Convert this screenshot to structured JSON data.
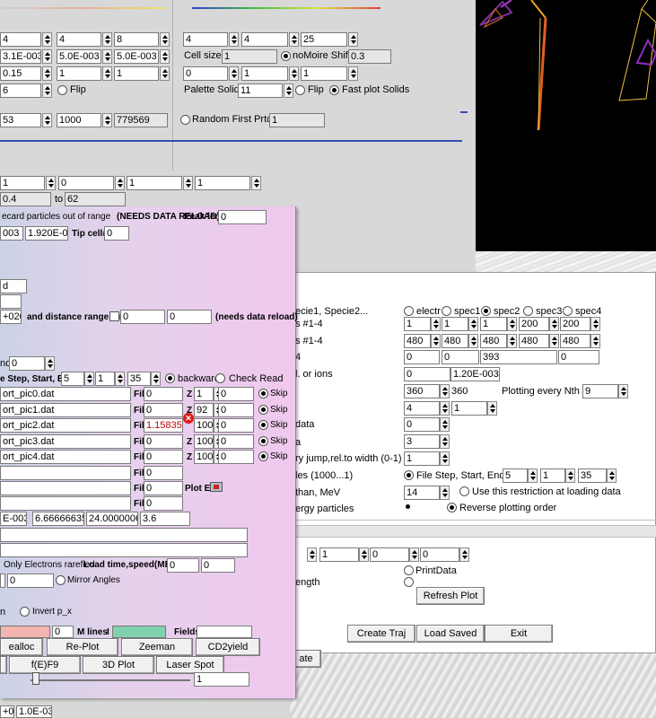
{
  "top": {
    "row1": {
      "a": "4",
      "b": "4",
      "c": "8",
      "d": "4",
      "e": "4",
      "f": "25"
    },
    "row2": {
      "a": "3.1E-003",
      "b": "5.0E-003",
      "c": "5.0E-003",
      "cell_size_label": "Cell size",
      "cell_size": "1",
      "nomoire_label": "noMoire Shift",
      "nomoire": "0.3"
    },
    "row3": {
      "a": "0.15",
      "b": "1",
      "c": "1",
      "d": "0",
      "e": "1",
      "f": "1"
    },
    "row4": {
      "a": "6",
      "flip_label": "Flip",
      "palette_label": "Palette Solid",
      "palette": "11",
      "flip2_label": "Flip",
      "fast_label": "Fast plot Solids"
    },
    "row5": {
      "a": "53",
      "b": "1000",
      "c": "779569",
      "random_label": "Random First Prtcl",
      "random": "1"
    },
    "row6": {
      "a": "1",
      "b": "0",
      "c": "1",
      "d": "1"
    },
    "row7": {
      "a": "0.4",
      "to_label": "to",
      "b": "62"
    }
  },
  "pink": {
    "discard_label": "ecard particles out of range",
    "needs_reload": "(NEEDS DATA RELOAD)",
    "peak_label": "Peak leng",
    "peak": "0",
    "r2": {
      "a": "003",
      "b": "1.920E-003",
      "tip_label": "Tip cell#",
      "tip": "0"
    },
    "r3": {
      "a": "d"
    },
    "r4": {
      "a": ""
    },
    "r5": {
      "a": "+020",
      "dist_label": "and distance range [cm]",
      "b": "0",
      "c": "0",
      "needs_reload": "(needs data reload)"
    },
    "r6": {
      "a": "nd",
      "b": "0"
    },
    "r7": {
      "step_label": "e Step, Start, End",
      "a": "5",
      "b": "1",
      "c": "35",
      "backward_label": "backward",
      "check_label": "Check Read"
    },
    "files": [
      {
        "name": "ort_pic0.dat",
        "fill": "0",
        "z": "1",
        "v": "0",
        "skip": "Skip"
      },
      {
        "name": "ort_pic1.dat",
        "fill": "0",
        "z": "92",
        "v": "0",
        "skip": "Skip"
      },
      {
        "name": "ort_pic2.dat",
        "fill": "1.158359",
        "z": "100",
        "v": "0",
        "skip": "Skip"
      },
      {
        "name": "ort_pic3.dat",
        "fill": "0",
        "z": "100",
        "v": "0",
        "skip": "Skip"
      },
      {
        "name": "ort_pic4.dat",
        "fill": "0",
        "z": "100",
        "v": "0",
        "skip": "Skip"
      }
    ],
    "fill_label": "Fill",
    "z_label": "Z",
    "extra_fill": [
      "0",
      "0",
      "0"
    ],
    "plot_ex_label": "Plot Ex",
    "r14": {
      "a": "E-003",
      "b": "6.66666635",
      "c": "24.00000061",
      "d": "3.6"
    },
    "only_electrons": "Only Electrons rarefied",
    "load_time_label": "Load time,speed(MBps):",
    "load_a": "0",
    "load_b": "0",
    "mirror": {
      "a": "",
      "b": "0",
      "label": "Mirror Angles"
    },
    "invert": {
      "pre": "n",
      "label": "Invert p_x"
    },
    "mlines": {
      "a": "0",
      "label": "M lines",
      "sep": "I",
      "fields_label": "Fields"
    },
    "buttons1": [
      "ealloc",
      "Re-Plot",
      "Zeeman",
      "CD2yield"
    ],
    "buttons2": [
      "",
      "f(E)F9",
      "3D Plot",
      "Laser Spot"
    ],
    "slider_val": "1",
    "bottom": {
      "a": "+03",
      "b": "1.0E-03"
    }
  },
  "white": {
    "species_label": "ecie1, Specie2...",
    "species": [
      "electr",
      "spec1",
      "spec2",
      "spec3",
      "spec4"
    ],
    "r1_label": "s #1-4",
    "r1": [
      "1",
      "1",
      "1",
      "200",
      "200"
    ],
    "r2_label": "s #1-4",
    "r2": [
      "480",
      "480",
      "480",
      "480",
      "480"
    ],
    "r3_label": "4",
    "r3": [
      "0",
      "0",
      "393",
      "0"
    ],
    "r4_label": "l. or ions",
    "r4": [
      "0",
      "1.20E-003"
    ],
    "r5": {
      "a": "360",
      "b": "360",
      "nth_label": "Plotting every Nth",
      "nth": "9"
    },
    "r6": {
      "a": "4",
      "b": "1"
    },
    "r7": {
      "label": "data",
      "a": "0"
    },
    "r8": {
      "label": "a",
      "a": "3"
    },
    "r9": {
      "label": "ry jump,rel.to width (0-1)",
      "a": "1"
    },
    "r10": {
      "label": "les (1000...1)",
      "step_label": "File Step,  Start, End",
      "a": "5",
      "b": "1",
      "c": "35"
    },
    "r11": {
      "label": "than, MeV",
      "a": "14",
      "use_label": "Use this restriction at loading data"
    },
    "r12": {
      "label": "ergy particles",
      "reverse_label": "Reverse plotting order"
    },
    "r13": [
      "0",
      "1",
      "0",
      "0"
    ],
    "print_label": "PrintData",
    "ength_label": "ength",
    "refresh_label": "Refresh Plot",
    "create_label": "Create Traj",
    "load_saved_label": "Load Saved",
    "exit_label": "Exit",
    "ate_label": "ate"
  },
  "icons": {
    "error": "error-icon",
    "camera": "plot-export-icon"
  }
}
